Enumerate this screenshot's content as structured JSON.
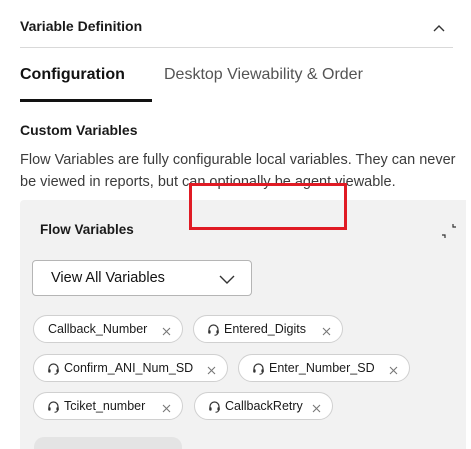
{
  "section": {
    "title": "Variable Definition",
    "collapse_icon": "chevron-up-icon"
  },
  "tabs": [
    {
      "label": "Configuration",
      "active": true
    },
    {
      "label": "Desktop Viewability & Order",
      "active": false
    }
  ],
  "custom_variables": {
    "title": "Custom Variables",
    "description": "Flow Variables are fully configurable local variables. They can never be viewed in reports, but can optionally be agent viewable."
  },
  "flow_variables": {
    "title": "Flow Variables",
    "expand_icon": "expand-corners-icon",
    "filter": {
      "selected": "View All Variables",
      "icon": "chevron-down-icon"
    },
    "chips": [
      {
        "label": "Callback_Number",
        "agent_viewable": false
      },
      {
        "label": "Entered_Digits",
        "agent_viewable": true
      },
      {
        "label": "Confirm_ANI_Num_SD",
        "agent_viewable": true
      },
      {
        "label": "Enter_Number_SD",
        "agent_viewable": true
      },
      {
        "label": "Tciket_number",
        "agent_viewable": true
      },
      {
        "label": "CallbackRetry",
        "agent_viewable": true
      }
    ],
    "remove_symbol": "×"
  },
  "colors": {
    "accent_text": "#121212",
    "panel_bg": "#f2f2f2",
    "highlight": "#e01b24",
    "divider": "#d9d9d9"
  }
}
